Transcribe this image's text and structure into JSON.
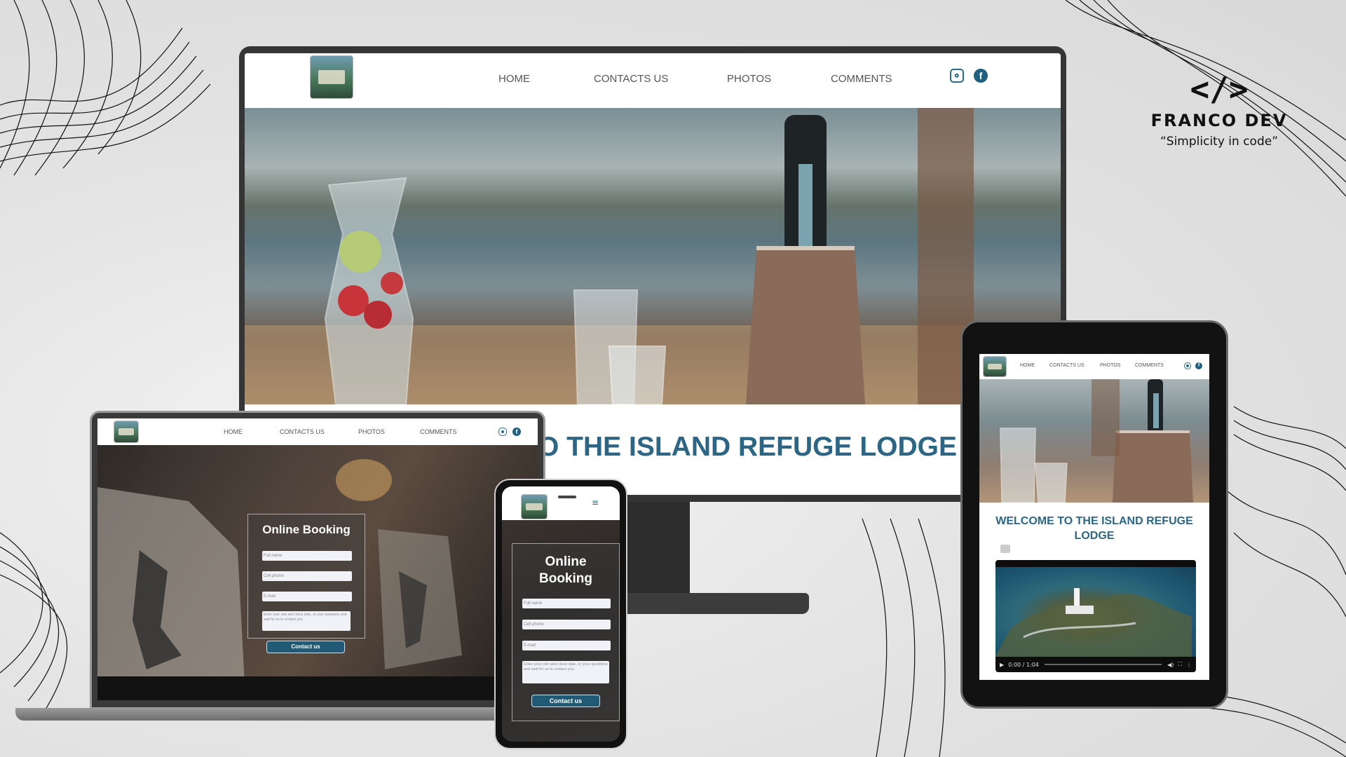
{
  "brand": {
    "name": "FRANCO DEV",
    "tagline": "“Simplicity in code”",
    "code_icon": "</>"
  },
  "nav": {
    "items": [
      "HOME",
      "CONTACTS US",
      "PHOTOS",
      "COMMENTS"
    ]
  },
  "hero": {
    "title_partial": "O THE ISLAND REFUGE LODGE",
    "title_full": "WELCOME TO THE ISLAND REFUGE LODGE"
  },
  "booking": {
    "title": "Online Booking",
    "full_name_placeholder": "Full name",
    "cell_phone_placeholder": "Cell phone",
    "email_placeholder": "E-mail",
    "message_placeholder": "Enter your ckin and ckout date, or your questions and wait for us to contact you.",
    "submit_label": "Contact us"
  },
  "video": {
    "time": "0:00 / 1:04"
  },
  "colors": {
    "accent": "#2d6684",
    "button": "#215a74",
    "device_frame": "#353535"
  },
  "icons": [
    "code-brackets-icon",
    "instagram-icon",
    "facebook-icon",
    "hamburger-menu-icon",
    "play-icon"
  ]
}
